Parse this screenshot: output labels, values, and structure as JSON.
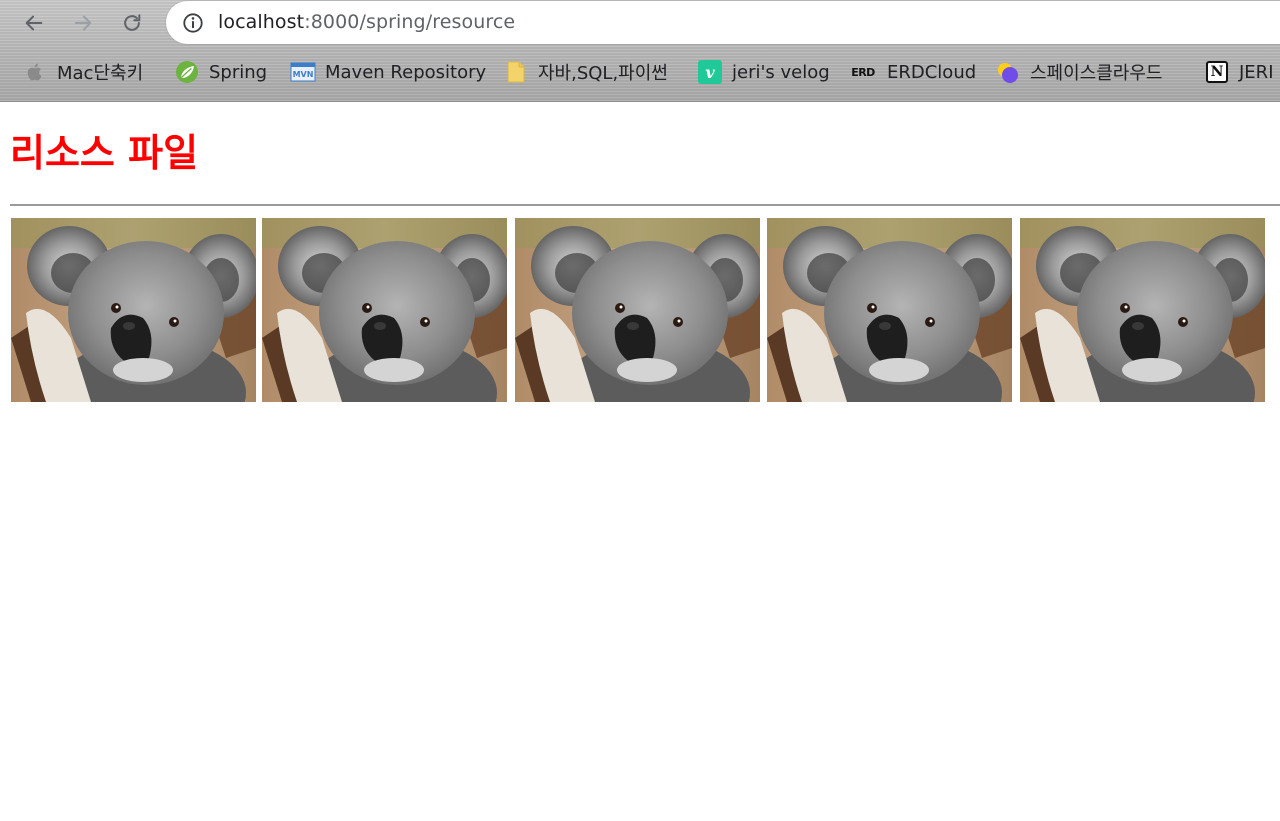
{
  "browser": {
    "url_host": "localhost",
    "url_path": ":8000/spring/resource",
    "nav_icons": [
      "back-arrow-icon",
      "forward-arrow-icon",
      "reload-icon",
      "info-icon"
    ]
  },
  "bookmarks": [
    {
      "label": "Mac단축키",
      "icon": "apple-icon"
    },
    {
      "label": "Spring",
      "icon": "spring-leaf-icon"
    },
    {
      "label": "Maven Repository",
      "icon": "maven-icon"
    },
    {
      "label": "자바,SQL,파이썬",
      "icon": "folder-icon"
    },
    {
      "label": "jeri's velog",
      "icon": "velog-icon"
    },
    {
      "label": "ERDCloud",
      "icon": "erd-icon",
      "icon_text": "ERD"
    },
    {
      "label": "스페이스클라우드",
      "icon": "spacecloud-icon"
    },
    {
      "label": "JERI",
      "icon": "notion-icon",
      "icon_text": "N"
    }
  ],
  "page": {
    "heading": "리소스 파일",
    "heading_color": "#ff0000",
    "images": [
      {
        "subject": "koala"
      },
      {
        "subject": "koala"
      },
      {
        "subject": "koala"
      },
      {
        "subject": "koala"
      },
      {
        "subject": "koala"
      }
    ]
  },
  "colors": {
    "spring": "#6db33f",
    "velog": "#20c997",
    "folder": "#f5d36b",
    "maven": "#3d7ec8"
  }
}
